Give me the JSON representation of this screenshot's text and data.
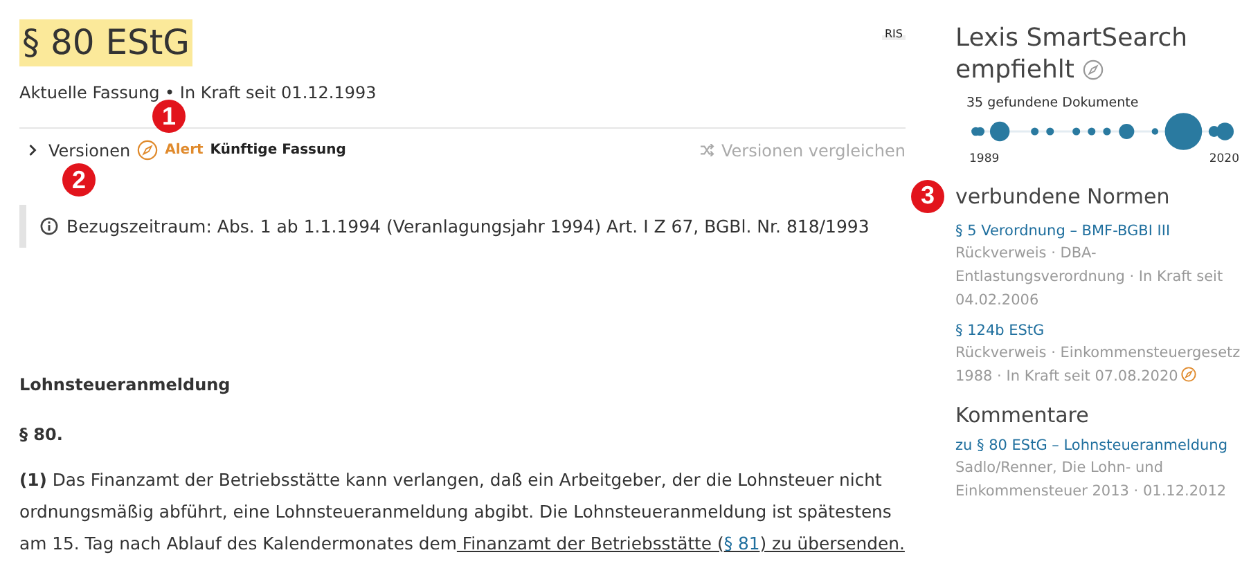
{
  "header": {
    "title": "§ 80 EStG",
    "subtitle": "Aktuelle Fassung • In Kraft seit 01.12.1993",
    "source_badge": "RIS"
  },
  "versions_bar": {
    "toggle_label": "Versionen",
    "alert_label": "Alert",
    "alert_text": "Künftige Fassung",
    "compare_label": "Versionen vergleichen"
  },
  "callouts": [
    {
      "number": "1"
    },
    {
      "number": "2"
    },
    {
      "number": "3"
    }
  ],
  "note": {
    "text": "Bezugszeitraum: Abs. 1 ab 1.1.1994 (Veranlagungsjahr 1994) Art. I Z 67, BGBl. Nr. 818/1993"
  },
  "document": {
    "heading": "Lohnsteueranmeldung",
    "section": "§ 80.",
    "paragraph": {
      "lead": "**(1)** Das Finanzamt der Betriebsstätte kann verlangen, daß ein Arbeitgeber, der die Lohnsteuer nicht ordnungsmäßig abführt, eine Lohnsteueranmeldung abgibt. Die Lohnsteueranmeldung ist spätestens am 15. Tag nach Ablauf des Kalendermonates dem",
      "underlined_before": " Finanzamt der Betriebsstätte (",
      "link": "§ 81",
      "underlined_after": ") zu übersenden."
    }
  },
  "sidebar": {
    "title": "Lexis SmartSearch empfiehlt",
    "timeline": {
      "caption": "35 gefundene Dokumente",
      "start": "1989",
      "end": "2020"
    },
    "sections": [
      {
        "heading": "verbundene Normen",
        "items": [
          {
            "title": "§ 5 Verordnung – BMF-BGBI III",
            "meta": "Rückverweis · DBA-Entlastungsverordnung · In Kraft seit 04.02.2006",
            "alert": false
          },
          {
            "title": "§ 124b EStG",
            "meta": "Rückverweis · Einkommensteuergesetz 1988 · In Kraft seit 07.08.2020",
            "alert": true
          }
        ]
      },
      {
        "heading": "Kommentare",
        "items": [
          {
            "title": "zu § 80 EStG – Lohnsteueranmeldung",
            "meta": "Sadlo/Renner, Die Lohn- und Einkommensteuer 2013 · 01.12.2012",
            "alert": false
          }
        ]
      }
    ]
  }
}
